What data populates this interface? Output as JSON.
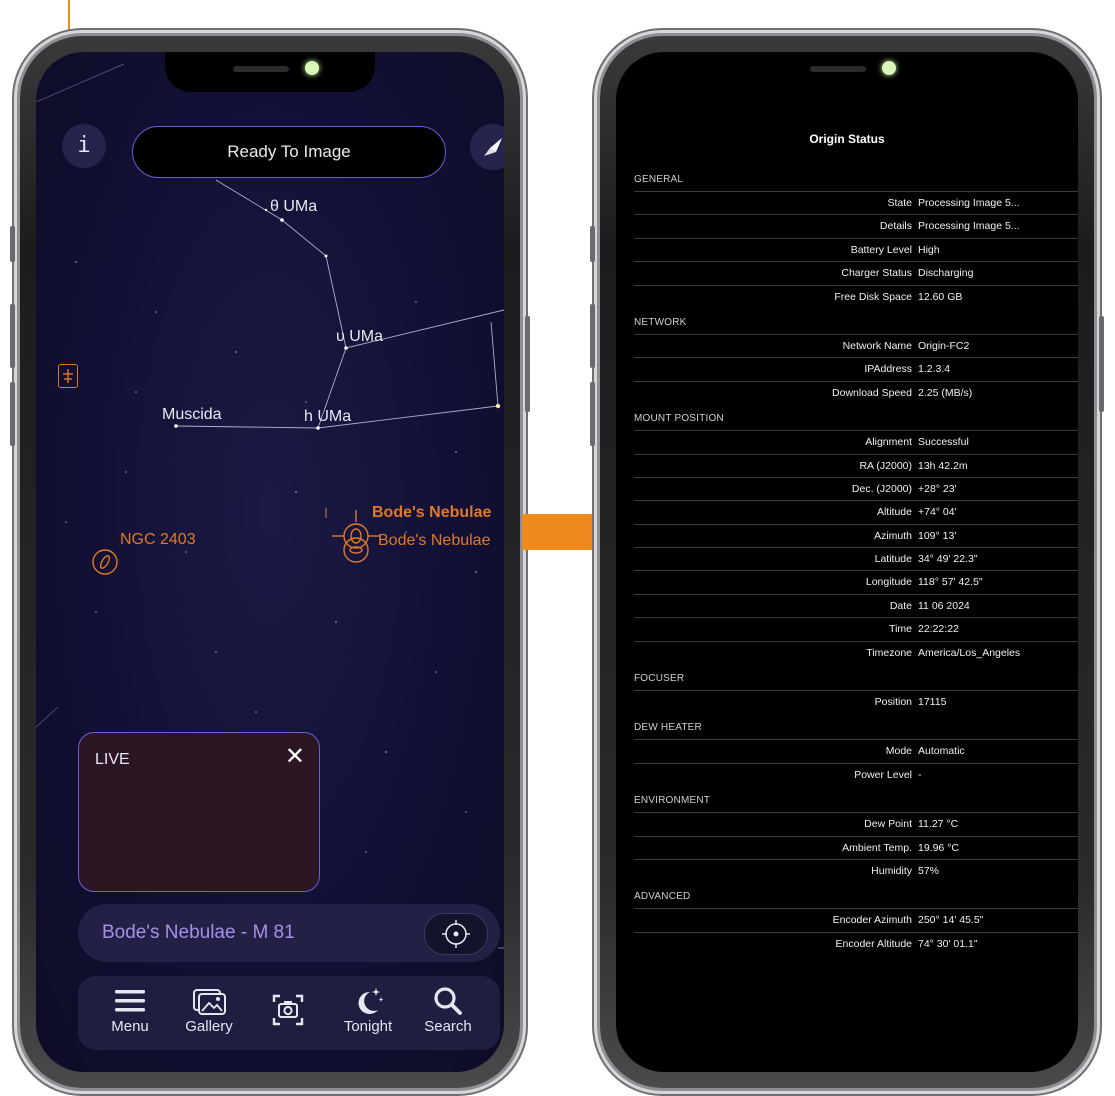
{
  "left": {
    "status_pill": "Ready To Image",
    "info_glyph": "i",
    "stars": {
      "theta": "θ UMa",
      "upsilon": "υ UMa",
      "muscida": "Muscida",
      "h": "h UMa"
    },
    "objects": {
      "bodes_bold": "Bode's Nebulae",
      "bodes": "Bode's Nebulae",
      "ngc": "NGC 2403"
    },
    "live": {
      "label": "LIVE",
      "close": "✕"
    },
    "target": {
      "name": "Bode's Nebulae - M 81"
    },
    "tabs": [
      {
        "label": "Menu",
        "icon": "menu-icon"
      },
      {
        "label": "Gallery",
        "icon": "gallery-icon"
      },
      {
        "label": "",
        "icon": "camera-icon"
      },
      {
        "label": "Tonight",
        "icon": "moon-stars-icon"
      },
      {
        "label": "Search",
        "icon": "search-icon"
      }
    ]
  },
  "right": {
    "title": "Origin Status",
    "sections": [
      {
        "name": "GENERAL",
        "rows": [
          {
            "k": "State",
            "v": "Processing Image 5..."
          },
          {
            "k": "Details",
            "v": "Processing Image 5..."
          },
          {
            "k": "Battery Level",
            "v": "High"
          },
          {
            "k": "Charger Status",
            "v": "Discharging"
          },
          {
            "k": "Free Disk Space",
            "v": "12.60 GB"
          }
        ]
      },
      {
        "name": "NETWORK",
        "rows": [
          {
            "k": "Network Name",
            "v": "Origin-FC2"
          },
          {
            "k": "IPAddress",
            "v": "1.2.3.4"
          },
          {
            "k": "Download Speed",
            "v": "2.25 (MB/s)"
          }
        ]
      },
      {
        "name": "MOUNT POSITION",
        "rows": [
          {
            "k": "Alignment",
            "v": "Successful"
          },
          {
            "k": "RA (J2000)",
            "v": "13h 42.2m"
          },
          {
            "k": "Dec. (J2000)",
            "v": "+28° 23'"
          },
          {
            "k": "Altitude",
            "v": "+74° 04'"
          },
          {
            "k": "Azimuth",
            "v": "109° 13'"
          },
          {
            "k": "Latitude",
            "v": "34° 49' 22.3\""
          },
          {
            "k": "Longitude",
            "v": "118° 57' 42.5\""
          },
          {
            "k": "Date",
            "v": "11 06 2024"
          },
          {
            "k": "Time",
            "v": "22:22:22"
          },
          {
            "k": "Timezone",
            "v": "America/Los_Angeles"
          }
        ]
      },
      {
        "name": "FOCUSER",
        "rows": [
          {
            "k": "Position",
            "v": "17115"
          }
        ]
      },
      {
        "name": "DEW HEATER",
        "rows": [
          {
            "k": "Mode",
            "v": "Automatic"
          },
          {
            "k": "Power Level",
            "v": "-"
          }
        ]
      },
      {
        "name": "ENVIRONMENT",
        "rows": [
          {
            "k": "Dew Point",
            "v": "11.27 °C"
          },
          {
            "k": "Ambient Temp.",
            "v": "19.96 °C"
          },
          {
            "k": "Humidity",
            "v": "57%"
          }
        ]
      },
      {
        "name": "ADVANCED",
        "rows": [
          {
            "k": "Encoder Azimuth",
            "v": "250° 14' 45.5\""
          },
          {
            "k": "Encoder Altitude",
            "v": "74° 30' 01.1\""
          }
        ]
      }
    ]
  },
  "colors": {
    "accent_orange": "#f08a1e",
    "purple": "#6c5cd8",
    "target_text": "#a88fe6"
  }
}
